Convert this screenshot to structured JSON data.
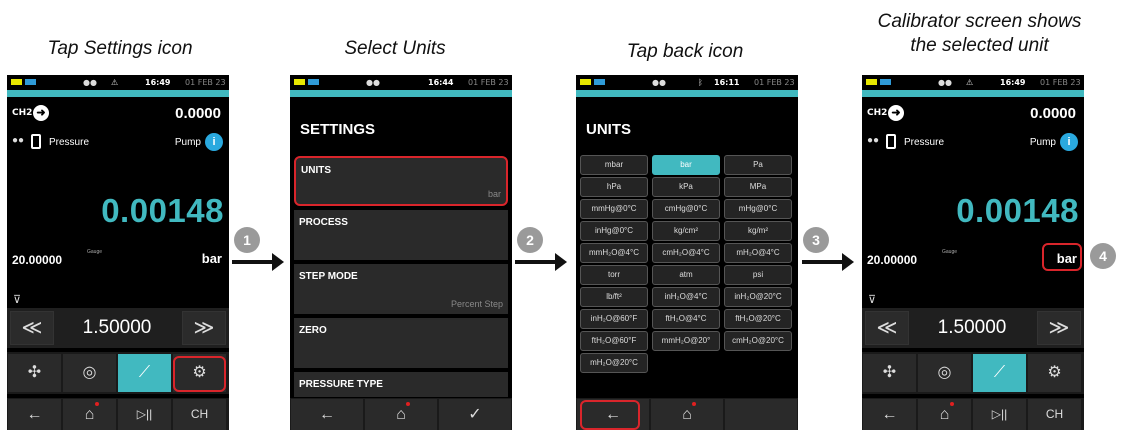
{
  "captions": {
    "step1": "Tap Settings icon",
    "step2": "Select Units",
    "step3": "Tap back icon",
    "step4_line1": "Calibrator screen shows",
    "step4_line2": "the selected unit"
  },
  "steps": [
    "1",
    "2",
    "3",
    "4"
  ],
  "main_screen": {
    "time": "16:49",
    "date": "01 FEB 23",
    "channel": "CH2",
    "channel_value": "0.0000",
    "function_label": "Pressure",
    "pump_label": "Pump",
    "reading": "0.00148",
    "range": "20.00000",
    "gauge_label": "Gauge",
    "unit": "bar",
    "step_value": "1.50000"
  },
  "settings_screen": {
    "time": "16:44",
    "date": "01 FEB 23",
    "title": "SETTINGS",
    "items": [
      {
        "label": "UNITS",
        "value": "bar"
      },
      {
        "label": "PROCESS",
        "value": ""
      },
      {
        "label": "STEP MODE",
        "value": "Percent Step"
      },
      {
        "label": "ZERO",
        "value": ""
      },
      {
        "label": "PRESSURE TYPE",
        "value": ""
      }
    ]
  },
  "units_screen": {
    "time": "16:11",
    "date": "01 FEB 23",
    "title": "UNITS",
    "selected": "bar",
    "units": [
      "mbar",
      "bar",
      "Pa",
      "hPa",
      "kPa",
      "MPa",
      "mmHg@0°C",
      "cmHg@0°C",
      "mHg@0°C",
      "inHg@0°C",
      "kg/cm²",
      "kg/m²",
      "mmH₂O@4°C",
      "cmH₂O@4°C",
      "mH₂O@4°C",
      "torr",
      "atm",
      "psi",
      "lb/ft²",
      "inH₂O@4°C",
      "inH₂O@20°C",
      "inH₂O@60°F",
      "ftH₂O@4°C",
      "ftH₂O@20°C",
      "ftH₂O@60°F",
      "mmH₂O@20°",
      "cmH₂O@20°C",
      "mH₂O@20°C"
    ]
  },
  "icons": {
    "back": "←",
    "home": "⌂",
    "play_pause": "▷||",
    "channel_settings": "CH",
    "double_left": "≪",
    "double_right": "≫",
    "check": "✓",
    "settings": "⚙",
    "fan": "✣",
    "loop": "◎",
    "wrench": "⟋"
  },
  "colors": {
    "accent": "#41b9c0",
    "highlight_box": "#d9252b",
    "pump_icon": "#2aa9df"
  }
}
